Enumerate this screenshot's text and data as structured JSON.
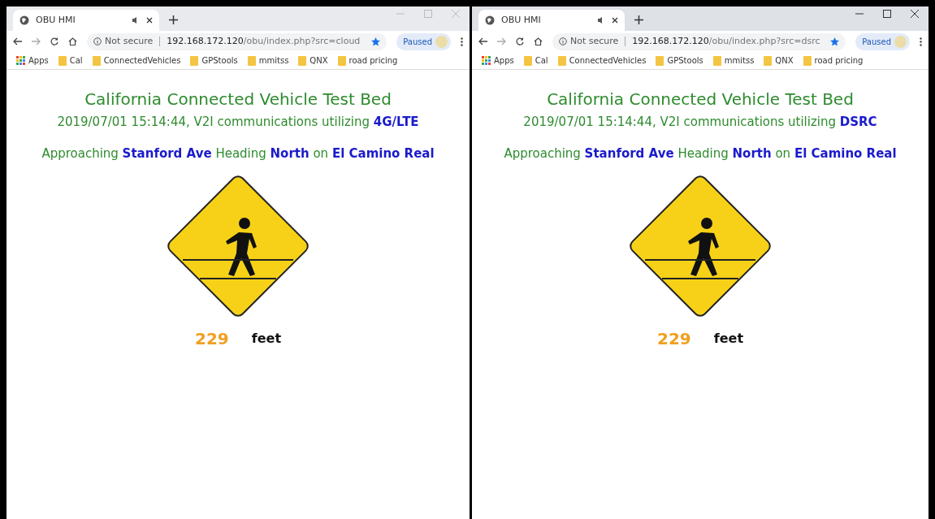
{
  "windows": [
    {
      "active": false,
      "tab_title": "OBU HMI",
      "url_note": "Not secure",
      "url_host": "192.168.172.120",
      "url_path": "/obu/index.php?src=cloud",
      "profile_label": "Paused",
      "bookmarks": [
        "Apps",
        "Cal",
        "ConnectedVehicles",
        "GPStools",
        "mmitss",
        "QNX",
        "road pricing"
      ],
      "heading": "California Connected Vehicle Test Bed",
      "subtitle": "2019/07/01 15:14:44, V2I communications utilizing **4G/LTE**",
      "approach": "Approaching **Stanford Ave** Heading **North** on **El Camino Real**",
      "distance": "229",
      "unit": "feet"
    },
    {
      "active": true,
      "tab_title": "OBU HMI",
      "url_note": "Not secure",
      "url_host": "192.168.172.120",
      "url_path": "/obu/index.php?src=dsrc",
      "profile_label": "Paused",
      "bookmarks": [
        "Apps",
        "Cal",
        "ConnectedVehicles",
        "GPStools",
        "mmitss",
        "QNX",
        "road pricing"
      ],
      "heading": "California Connected Vehicle Test Bed",
      "subtitle": "2019/07/01 15:14:44, V2I communications utilizing **DSRC**",
      "approach": "Approaching **Stanford Ave** Heading **North** on **El Camino Real**",
      "distance": "229",
      "unit": "feet"
    }
  ]
}
